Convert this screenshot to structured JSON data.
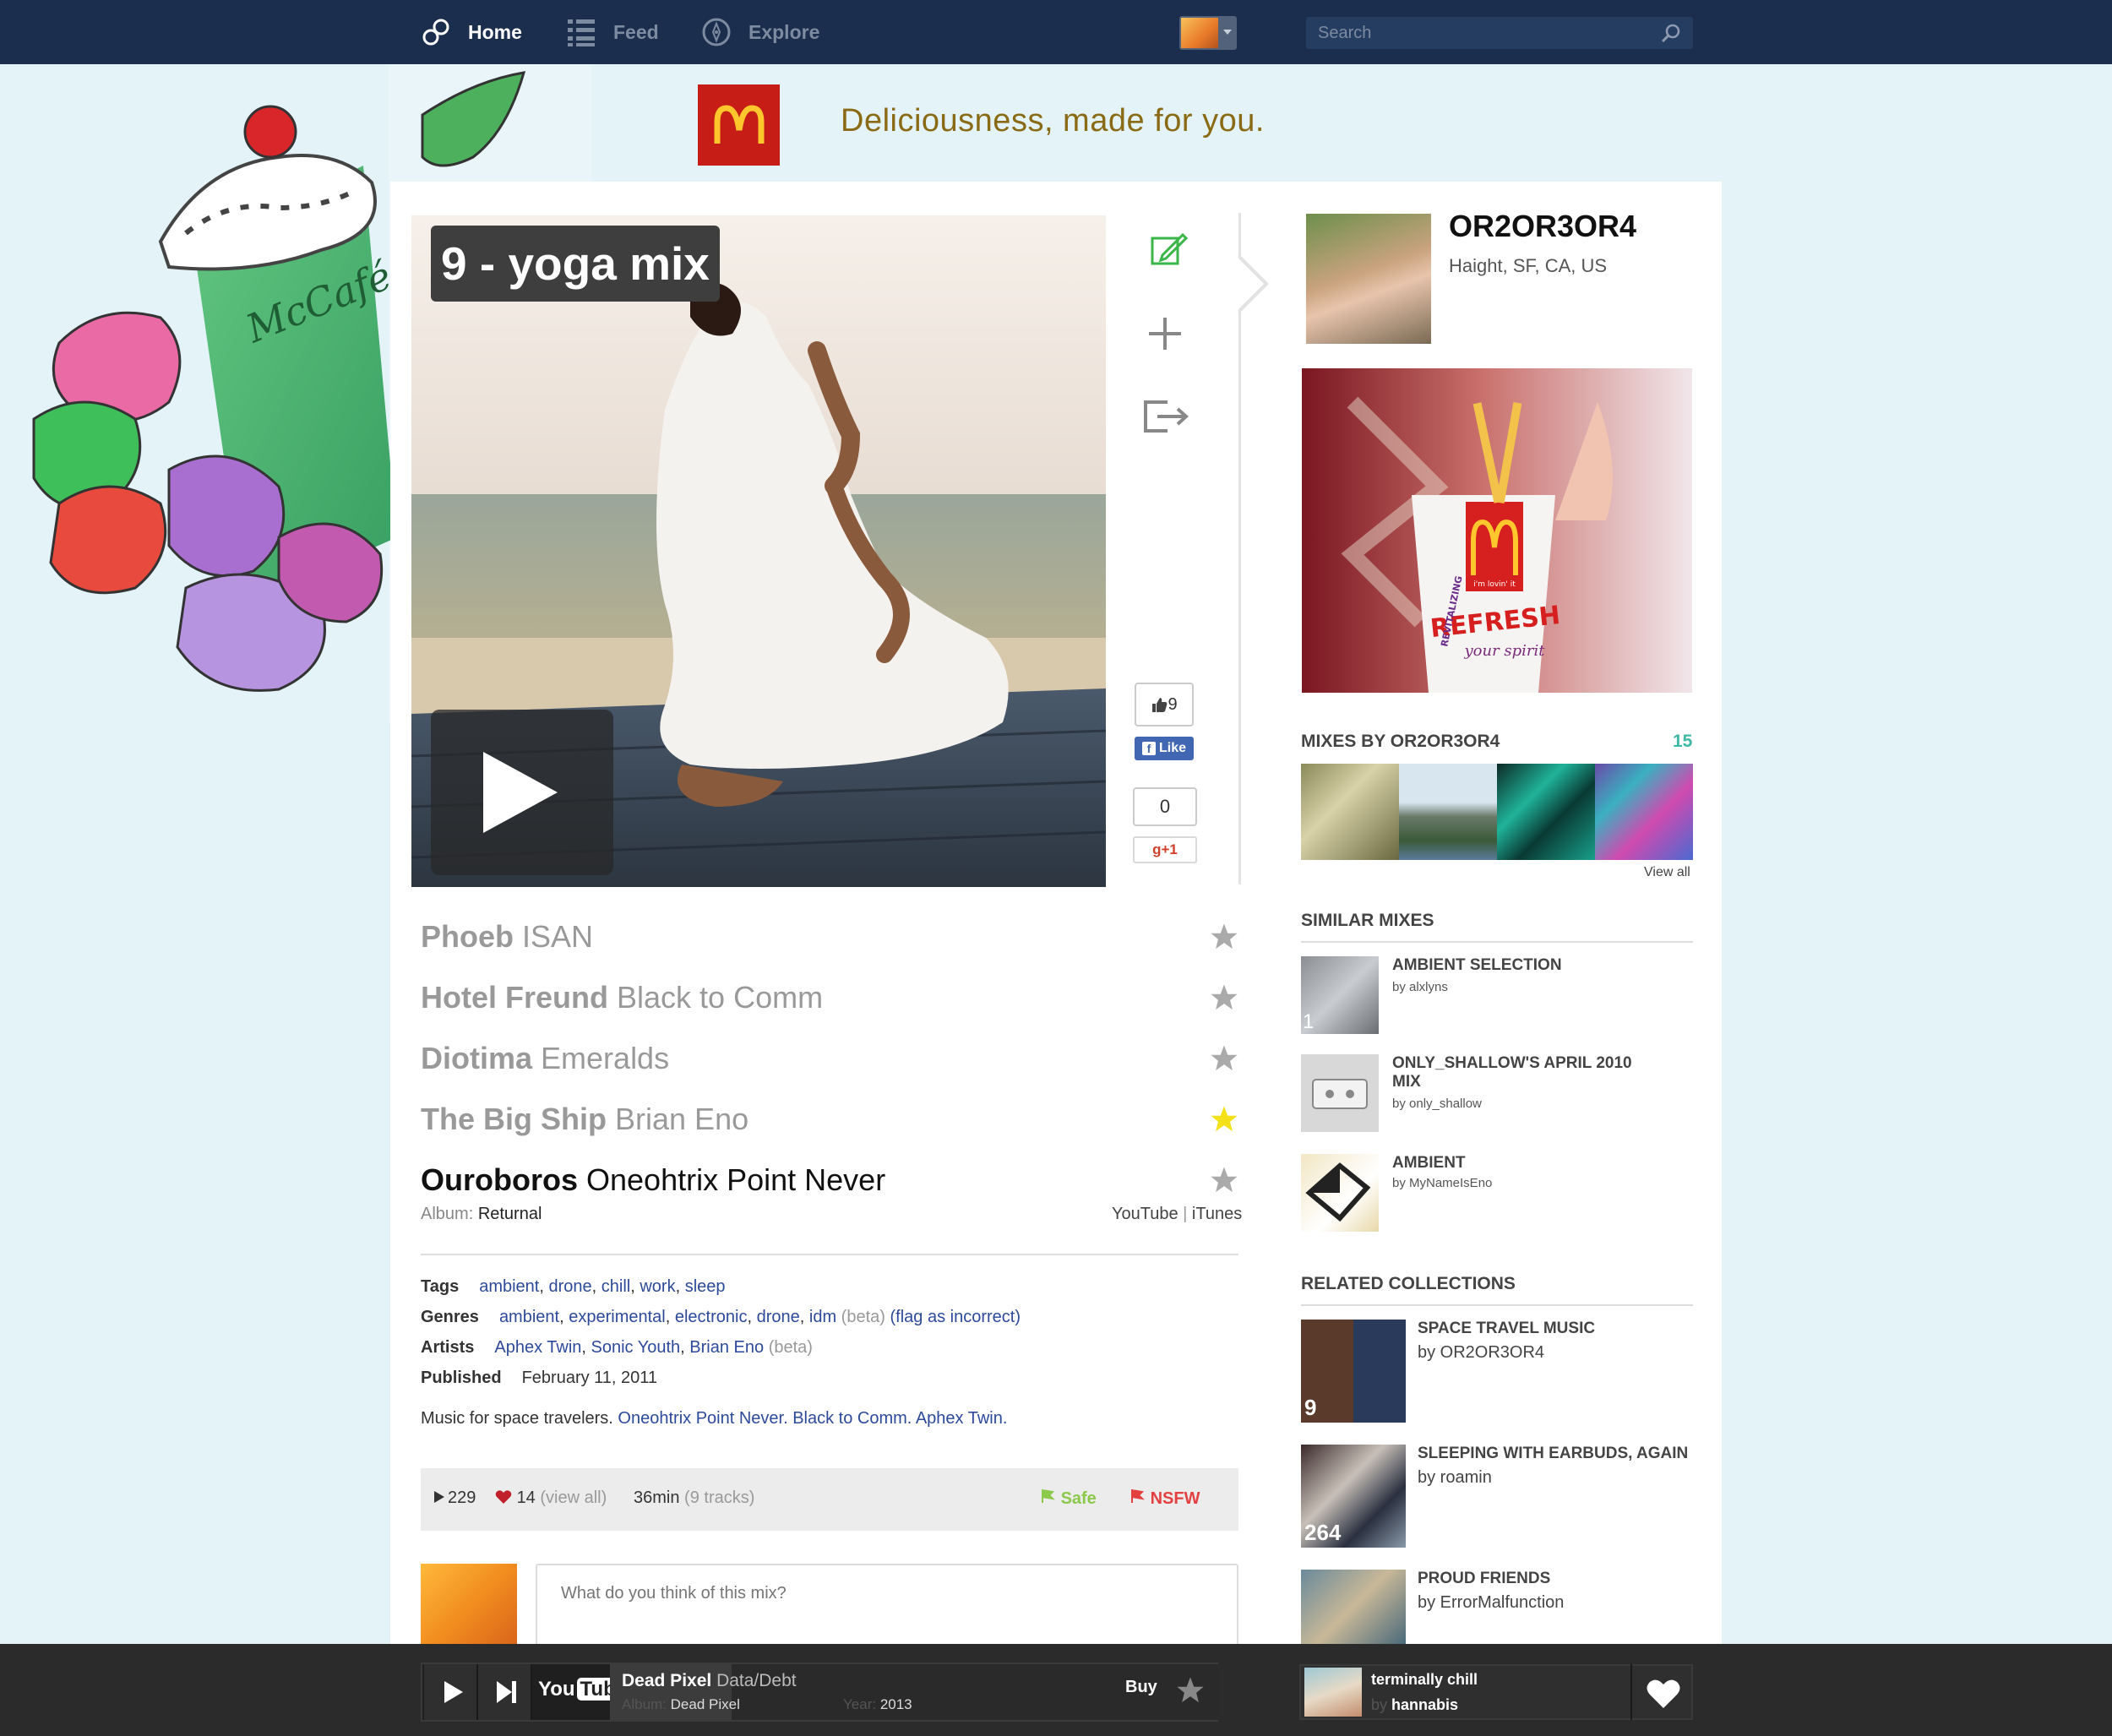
{
  "nav": {
    "home": "Home",
    "feed": "Feed",
    "explore": "Explore",
    "search_placeholder": "Search"
  },
  "banner": {
    "logo_letter": "M",
    "tagline": "Deliciousness, made for you."
  },
  "mix": {
    "title": "9 - yoga mix",
    "likes": "9",
    "fb_like": "Like",
    "gplus_count": "0",
    "gplus": "g+1",
    "tracks": [
      {
        "title": "Phoeb",
        "artist": "ISAN",
        "starred": false
      },
      {
        "title": "Hotel Freund",
        "artist": "Black to Comm",
        "starred": false
      },
      {
        "title": "Diotima",
        "artist": "Emeralds",
        "starred": false
      },
      {
        "title": "The Big Ship",
        "artist": "Brian Eno",
        "starred": true
      },
      {
        "title": "Ouroboros",
        "artist": "Oneohtrix Point Never",
        "starred": false,
        "current": true
      }
    ],
    "album_label": "Album:",
    "album": "Returnal",
    "youtube": "YouTube",
    "link_sep": "|",
    "itunes": "iTunes",
    "tags_label": "Tags",
    "tags": [
      "ambient",
      "drone",
      "chill",
      "work",
      "sleep"
    ],
    "genres_label": "Genres",
    "genres": [
      "ambient",
      "experimental",
      "electronic",
      "drone",
      "idm"
    ],
    "genres_beta": "(beta)",
    "genres_flag": "(flag as incorrect)",
    "artists_label": "Artists",
    "artists": [
      "Aphex Twin",
      "Sonic Youth",
      "Brian Eno"
    ],
    "artists_beta": "(beta)",
    "published_label": "Published",
    "published": "February 11, 2011",
    "desc_prefix": "Music for space travelers.",
    "desc_links": [
      "Oneohtrix Point Never.",
      "Black to Comm.",
      "Aphex Twin."
    ],
    "plays": "229",
    "hearts": "14",
    "view_all": "(view all)",
    "duration": "36min",
    "track_count": "(9 tracks)",
    "safe": "Safe",
    "nsfw": "NSFW",
    "comment_placeholder": "What do you think of this mix?"
  },
  "profile": {
    "name": "OR2OR3OR4",
    "location": "Haight, SF, CA, US",
    "ad_text_top": "i'm lovin' it",
    "ad_text_main": "REFRESH",
    "ad_text_sub": "your spirit",
    "ad_side": "REVITALIZING",
    "mixes_heading": "MIXES BY OR2OR3OR4",
    "mixes_count": "15",
    "view_all": "View all",
    "similar_heading": "SIMILAR MIXES",
    "similar": [
      {
        "title": "AMBIENT SELECTION",
        "by": "by alxlyns",
        "badge": "1"
      },
      {
        "title": "ONLY_SHALLOW'S APRIL 2010 MIX",
        "by": "by only_shallow"
      },
      {
        "title": "AMBIENT",
        "by": "by MyNameIsEno"
      }
    ],
    "collections_heading": "RELATED COLLECTIONS",
    "collections": [
      {
        "title": "SPACE TRAVEL MUSIC",
        "by": "by OR2OR3OR4",
        "badge": "9"
      },
      {
        "title": "SLEEPING WITH EARBUDS, AGAIN",
        "by": "by roamin",
        "badge": "264"
      },
      {
        "title": "PROUD FRIENDS",
        "by": "by ErrorMalfunction"
      }
    ]
  },
  "player": {
    "youtube_a": "You",
    "youtube_b": "Tube",
    "track": "Dead Pixel",
    "artist": "Data/Debt",
    "album_label": "Album:",
    "album": "Dead Pixel",
    "year_label": "Year:",
    "year": "2013",
    "buy": "Buy",
    "mix_title": "terminally chill",
    "mix_by_label": "by",
    "mix_by": "hannabis"
  },
  "colors": {
    "nav_bg": "#1b2e4d",
    "page_bg": "#e3f3f8",
    "link": "#2d4a9a",
    "accent_teal": "#3cb8a4",
    "star_active": "#f4e11a",
    "mcd_red": "#c61d17"
  }
}
